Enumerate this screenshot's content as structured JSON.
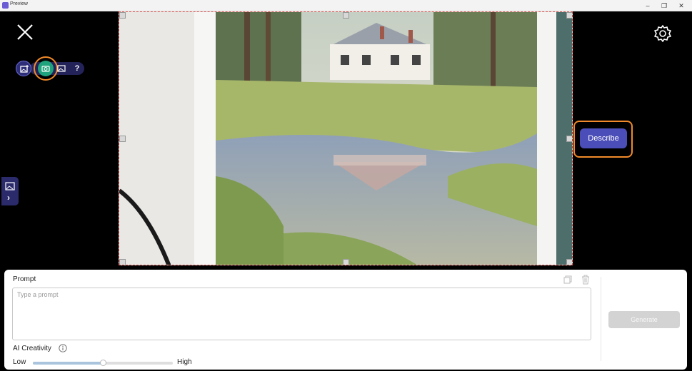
{
  "window": {
    "title": "Preview",
    "minimize": "–",
    "maximize": "❐",
    "close": "✕"
  },
  "toolbar": {
    "icons": [
      "image-add-icon",
      "camera-icon",
      "image-icon",
      "help-icon"
    ],
    "help_label": "?"
  },
  "stage": {
    "describe_label": "Describe",
    "left_tab_arrow": "›"
  },
  "prompt": {
    "label": "Prompt",
    "placeholder": "Type a prompt"
  },
  "generate": {
    "label": "Generate"
  },
  "creativity": {
    "label": "AI Creativity",
    "low": "Low",
    "high": "High",
    "value": 0.5
  },
  "colors": {
    "accent": "#4b4db8",
    "highlight": "#f08a2a",
    "camera_active": "#1fa37c"
  }
}
